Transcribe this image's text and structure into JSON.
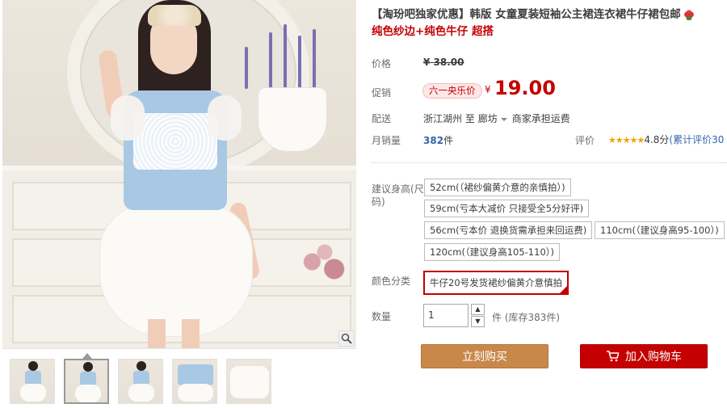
{
  "product": {
    "title_line1": "【淘玢吧独家优惠】韩版 女童夏装短袖公主裙连衣裙牛仔裙包邮",
    "title_line2": "纯色纱边+纯色牛仔 超搭"
  },
  "price": {
    "label": "价格",
    "original": "¥ 38.00"
  },
  "promo": {
    "label": "促销",
    "badge": "六一央乐价",
    "currency": "¥",
    "value": "19.00"
  },
  "shipping": {
    "label": "配送",
    "from": "浙江湖州",
    "to_word": "至",
    "destination": "廊坊",
    "note": "商家承担运费"
  },
  "sales": {
    "label": "月销量",
    "count": "382",
    "unit": "件",
    "rating_label": "评价",
    "stars": "★★★★★",
    "score": "4.8分",
    "review_link": "(累计评价30"
  },
  "height": {
    "label": "建议身高(尺码)",
    "options": [
      "52cm(（裙纱偏黄介意的亲慎拍）)",
      "59cm(亏本大减价 只接受全5分好评)",
      "56cm(亏本价 退换货需承担来回运费)",
      "110cm(（建议身高95-100）)",
      "120cm(（建议身高105-110）)"
    ]
  },
  "color": {
    "label": "颜色分类",
    "option": "牛仔20号发货裙纱偏黄介意慎拍"
  },
  "quantity": {
    "label": "数量",
    "value": "1",
    "unit": "件",
    "stock": "(库存383件)"
  },
  "buttons": {
    "buy_now": "立刻购买",
    "add_to_cart": "加入购物车"
  },
  "gallery": {
    "zoom_icon": "search-icon",
    "thumb_count": 5
  }
}
